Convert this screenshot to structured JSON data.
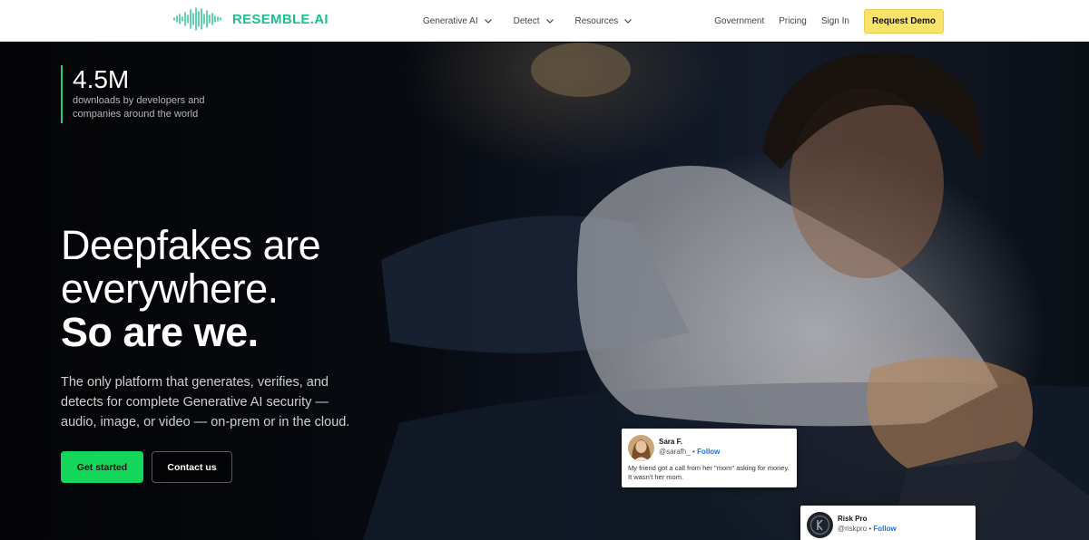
{
  "brand": {
    "name": "RESEMBLE.AI",
    "color": "#1fbf8f"
  },
  "nav": {
    "menus": [
      {
        "label": "Generative AI",
        "icon": "chevron-down-icon"
      },
      {
        "label": "Detect",
        "icon": "chevron-down-icon"
      },
      {
        "label": "Resources",
        "icon": "chevron-down-icon"
      }
    ],
    "links": [
      "Government",
      "Pricing",
      "Sign In"
    ],
    "cta": "Request Demo"
  },
  "hero": {
    "stat": {
      "value": "4.5M",
      "desc": "downloads by developers and companies around the world"
    },
    "headline_line1": "Deepfakes are everywhere.",
    "headline_line2": "So are we.",
    "subtext": "The only platform that generates, verifies, and detects for complete Generative AI security — audio, image, or video — on-prem or in the cloud.",
    "primary_button": "Get started",
    "secondary_button": "Contact us",
    "accent_color": "#13d65a"
  },
  "testimonials": [
    {
      "name": "Sara F.",
      "handle": "@sarafh_",
      "follow": "Follow",
      "text": "My friend got a call from her \"mom\" asking for money. It wasn't her mom."
    },
    {
      "name": "Risk Pro",
      "handle": "@riskpro",
      "follow": "Follow"
    }
  ]
}
